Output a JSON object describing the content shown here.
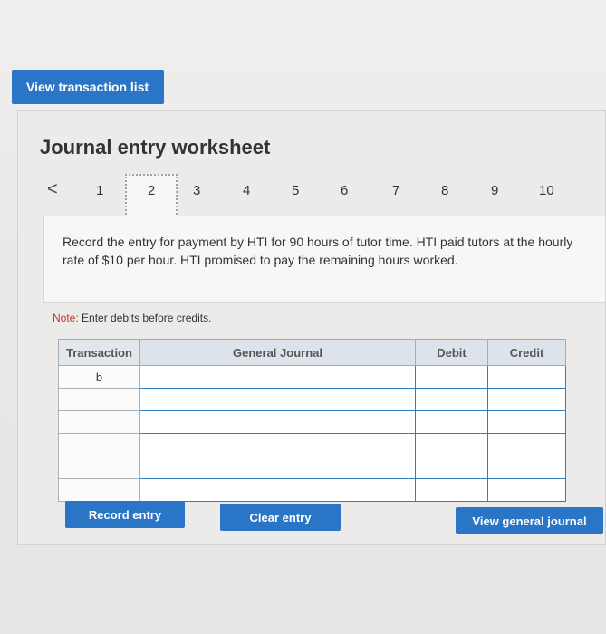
{
  "top": {
    "view_transaction_list": "View transaction list"
  },
  "worksheet": {
    "title": "Journal entry worksheet",
    "pager": {
      "prev_symbol": "<",
      "pages": [
        "1",
        "2",
        "3",
        "4",
        "5",
        "6",
        "7",
        "8",
        "9",
        "10"
      ],
      "active_page": "2"
    },
    "prompt": "Record the entry for payment by HTI for 90 hours of tutor time. HTI paid tutors at the hourly rate of $10 per hour. HTI promised to pay the remaining hours worked.",
    "note_label": "Note:",
    "note_text": "Enter debits before credits.",
    "table": {
      "headers": [
        "Transaction",
        "General Journal",
        "Debit",
        "Credit"
      ],
      "rows": [
        {
          "transaction": "b"
        },
        {
          "transaction": ""
        },
        {
          "transaction": ""
        },
        {
          "transaction": ""
        },
        {
          "transaction": ""
        },
        {
          "transaction": ""
        }
      ]
    },
    "buttons": {
      "record": "Record entry",
      "clear": "Clear entry",
      "view_general_journal": "View general journal"
    }
  }
}
